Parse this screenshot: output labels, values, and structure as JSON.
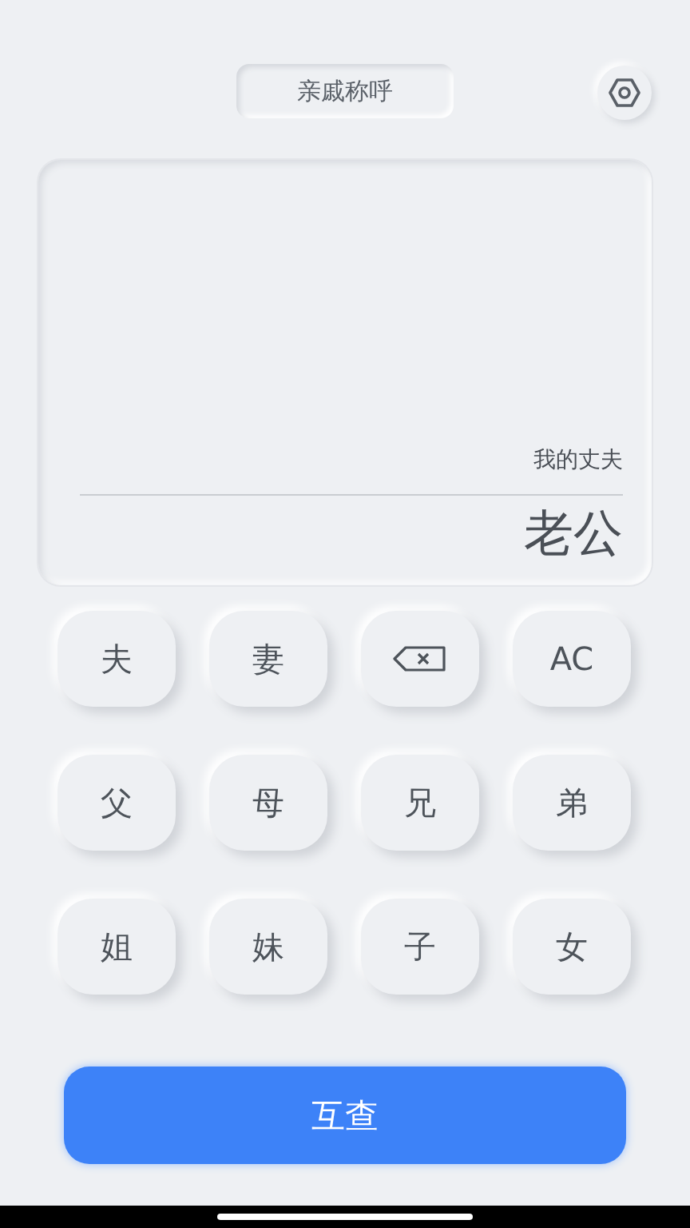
{
  "header": {
    "title": "亲戚称呼"
  },
  "display": {
    "expression": "我的丈夫",
    "result": "老公"
  },
  "keys": [
    {
      "kind": "text",
      "label": "夫"
    },
    {
      "kind": "text",
      "label": "妻"
    },
    {
      "kind": "backspace"
    },
    {
      "kind": "text",
      "label": "AC"
    },
    {
      "kind": "text",
      "label": "父"
    },
    {
      "kind": "text",
      "label": "母"
    },
    {
      "kind": "text",
      "label": "兄"
    },
    {
      "kind": "text",
      "label": "弟"
    },
    {
      "kind": "text",
      "label": "姐"
    },
    {
      "kind": "text",
      "label": "妹"
    },
    {
      "kind": "text",
      "label": "子"
    },
    {
      "kind": "text",
      "label": "女"
    }
  ],
  "action_button": {
    "label": "互查"
  }
}
